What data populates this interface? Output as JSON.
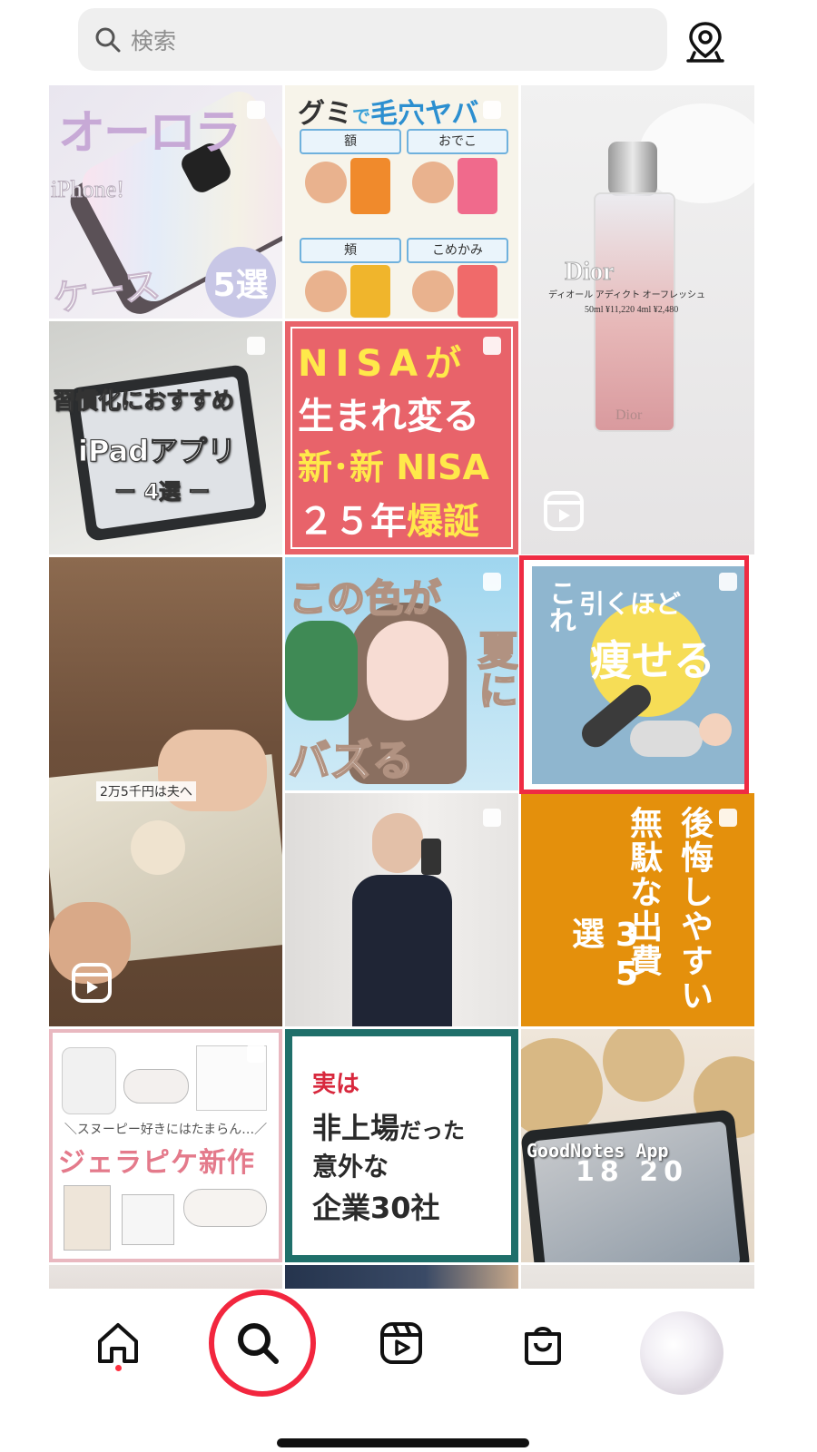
{
  "search": {
    "placeholder": "検索",
    "icon": "search-icon"
  },
  "header": {
    "location_icon": "map-pin-icon"
  },
  "tiles": {
    "aurora": {
      "title": "オーロラ",
      "sub": "iPhone!",
      "bottom": "ケース",
      "badge": "5選"
    },
    "gummy": {
      "title_a": "グミ",
      "title_b": "で",
      "title_c": "毛穴ヤバ",
      "labels": [
        "額",
        "おでこ",
        "頬",
        "こめかみ"
      ]
    },
    "dior": {
      "brand": "Dior",
      "name": "ディオール アディクト オーフレッシュ",
      "price": "50ml ¥11,220 4ml ¥2,480",
      "bottle_brand": "Dior"
    },
    "ipad": {
      "line1": "習慣化におすすめ",
      "line2": "iPadアプリ",
      "line3": "ー 4選 ー"
    },
    "nisa": {
      "line1": "NISAが",
      "line2": "生まれ変る",
      "line3": "新･新 NISA",
      "line4_a": "２５年",
      "line4_b": "爆誕"
    },
    "money": {
      "caption": "2万5千円は夫へ"
    },
    "color": {
      "line1": "この色が",
      "line2": "夏に",
      "line3": "バズる"
    },
    "yoga": {
      "kore": "これ",
      "line1": "引くほど",
      "line2": "痩せる"
    },
    "waste": {
      "col1": "後悔しやすい",
      "col2": "無駄な出費",
      "col3": "35選"
    },
    "snoopy": {
      "banner": "＼スヌーピー好きにはたまらん…／",
      "title": "ジェラピケ新作"
    },
    "companies": {
      "line1": "実は",
      "line2_a": "非上場",
      "line2_b": "だった",
      "line3": "意外な",
      "line4": "企業30社"
    },
    "goodnotes": {
      "title": "GoodNotes App",
      "clock": "18 20"
    }
  },
  "nav": {
    "home": "home-icon",
    "search": "search-icon",
    "reels": "reels-icon",
    "shop": "shop-icon",
    "profile": "profile-avatar"
  },
  "colors": {
    "accent": "#f2263e",
    "nisa_red": "#e8636a",
    "nisa_yellow": "#ffe94a",
    "waste_orange": "#e4900c",
    "yoga_blue": "#8fb6cf"
  }
}
